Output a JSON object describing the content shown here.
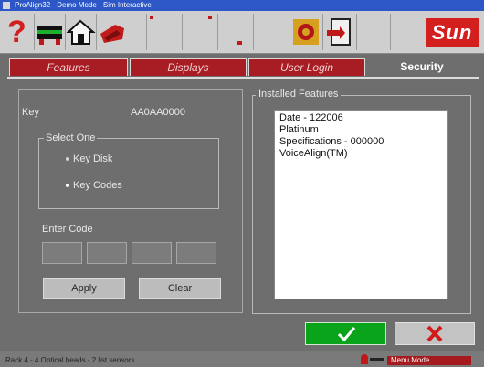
{
  "window": {
    "title": "ProAlign32 · Demo Mode · Sim Interactive"
  },
  "toolbar": {
    "buttons": [
      "help-icon",
      "vehicle-icon",
      "home-icon",
      "sensor-icon",
      "blank",
      "blank",
      "blank",
      "blank",
      "settings-icon",
      "export-icon"
    ],
    "brand": "Sun"
  },
  "tabs": [
    {
      "label": "Features"
    },
    {
      "label": "Displays"
    },
    {
      "label": "User Login"
    },
    {
      "label": "Security"
    }
  ],
  "security": {
    "key_label": "Key",
    "key_value": "AA0AA0000",
    "select_one_label": "Select One",
    "options": [
      {
        "label": "Key Disk",
        "selected": false
      },
      {
        "label": "Key Codes",
        "selected": true
      }
    ],
    "enter_code_label": "Enter Code",
    "code_fields": [
      "",
      "",
      "",
      ""
    ],
    "apply_label": "Apply",
    "clear_label": "Clear"
  },
  "installed": {
    "label": "Installed Features",
    "items": [
      "Date - 122006",
      "Platinum",
      "Specifications - 000000",
      "VoiceAlign(TM)"
    ]
  },
  "status": {
    "left": "Rack 4 - 4 Optical heads - 2 list sensors",
    "right": "Menu Mode"
  },
  "colors": {
    "accent": "#a81c24",
    "ok": "#0aa41a",
    "panel": "#6e6e6e"
  }
}
